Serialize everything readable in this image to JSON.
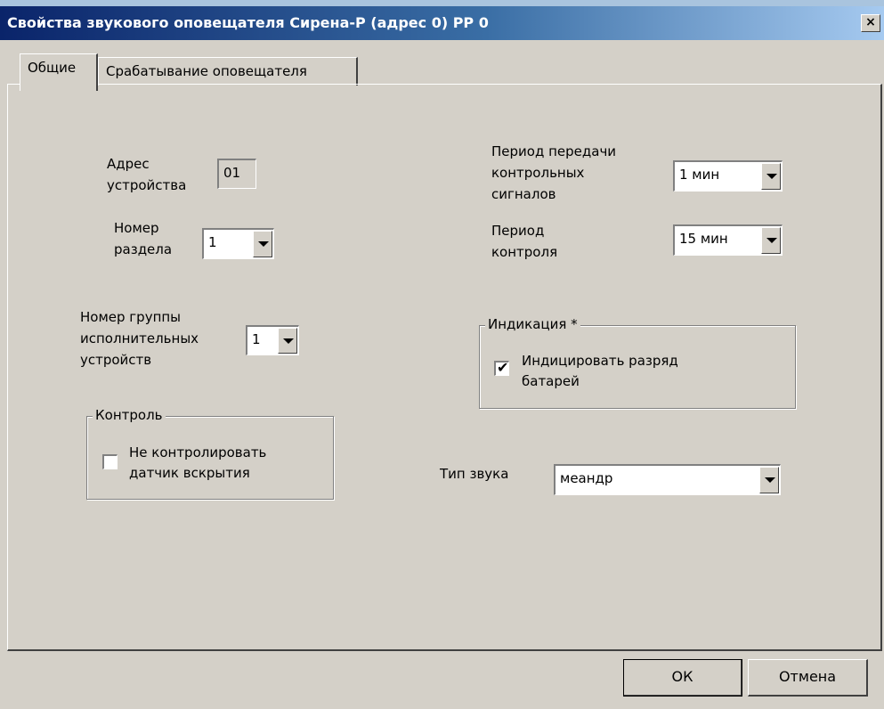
{
  "window": {
    "title": "Свойства звукового оповещателя Сирена-Р (адрес 0) РР 0",
    "close_symbol": "×"
  },
  "tabs": [
    {
      "label": "Общие",
      "active": true
    },
    {
      "label": "Срабатывание оповещателя",
      "active": false
    }
  ],
  "general": {
    "address_label_1": "Адрес",
    "address_label_2": "устройства",
    "address_value": "01",
    "section_label_1": "Номер",
    "section_label_2": "раздела",
    "section_value": "1",
    "group_label_1": "Номер группы",
    "group_label_2": "исполнительных",
    "group_label_3": "устройств",
    "group_value": "1",
    "control": {
      "legend": "Контроль",
      "checkbox_label_1": "Не контролировать",
      "checkbox_label_2": "датчик вскрытия",
      "checked": false
    },
    "period_tx_label_1": "Период передачи",
    "period_tx_label_2": "контрольных",
    "period_tx_label_3": "сигналов",
    "period_tx_value": "1 мин",
    "period_ctrl_label_1": "Период",
    "period_ctrl_label_2": "контроля",
    "period_ctrl_value": "15 мин",
    "indication": {
      "legend": "Индикация *",
      "checkbox_label_1": "Индицировать разряд",
      "checkbox_label_2": "батарей",
      "checked": true,
      "check_mark": "✔"
    },
    "sound_type_label": "Тип звука",
    "sound_type_value": "меандр"
  },
  "buttons": {
    "ok": "ОК",
    "cancel": "Отмена"
  },
  "colors": {
    "title_bar_start": "#0a246a",
    "title_bar_end": "#a6caf0",
    "window_face": "#d4d0c8"
  },
  "icons": {
    "close": "close-icon",
    "dropdown": "chevron-down-icon",
    "check": "checkmark-icon"
  }
}
